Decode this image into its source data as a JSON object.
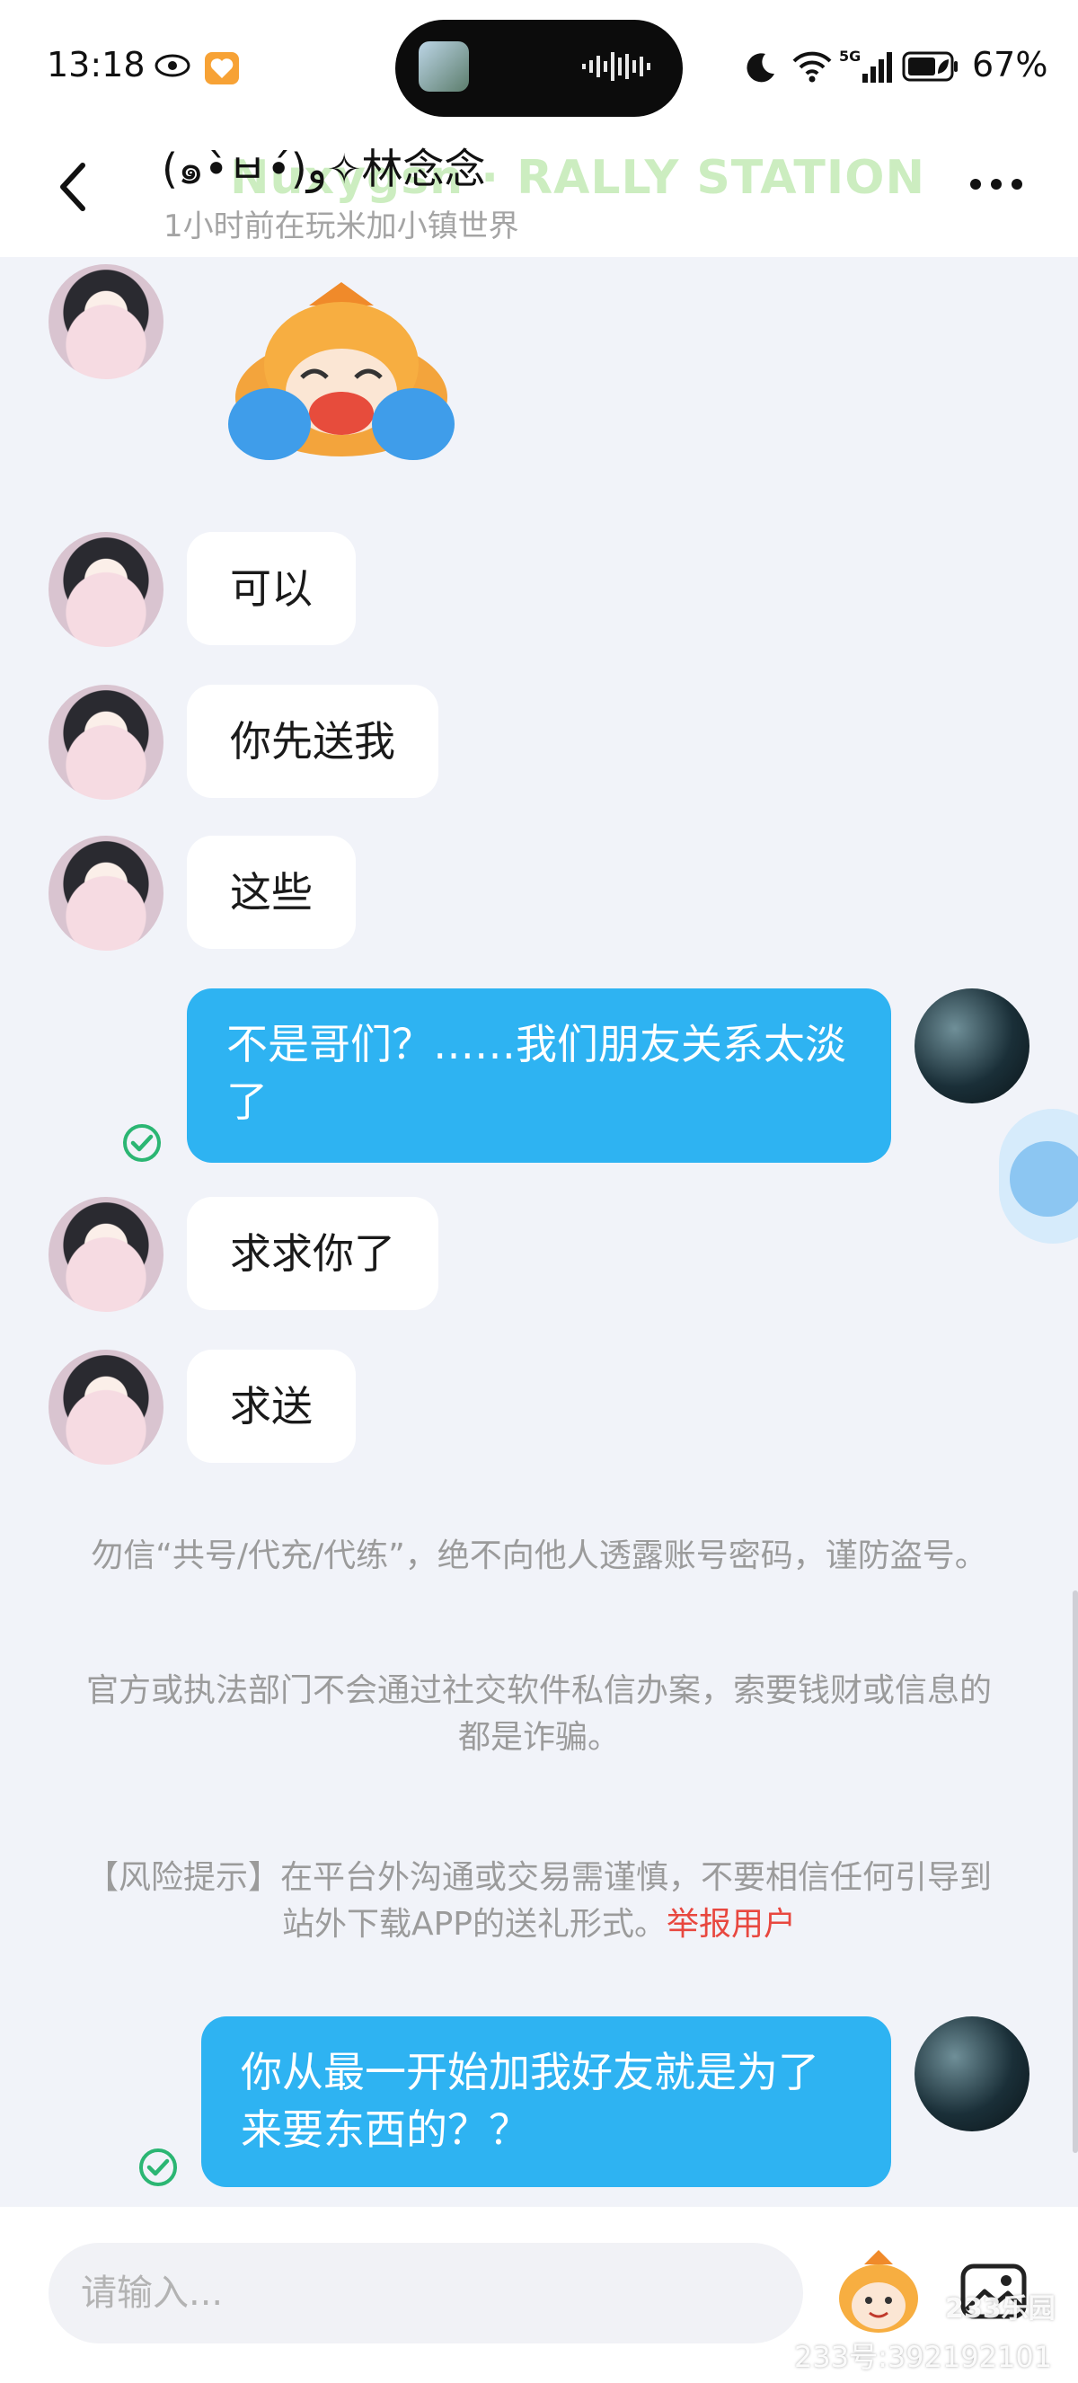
{
  "status": {
    "time": "13:18",
    "battery": "67%",
    "network": "5G"
  },
  "header": {
    "title": "(๑•̀ㅂ•́)و✧林念念",
    "watermark": "Nuxygsn · RALLY STATION",
    "subtitle": "1小时前在玩米加小镇世界"
  },
  "messages": [
    {
      "side": "in",
      "text": "可以"
    },
    {
      "side": "in",
      "text": "你先送我"
    },
    {
      "side": "in",
      "text": "这些"
    },
    {
      "side": "out",
      "text": "不是哥们？……我们朋友关系太淡了"
    },
    {
      "side": "in",
      "text": "求求你了"
    },
    {
      "side": "in",
      "text": "求送"
    },
    {
      "side": "out",
      "text": "你从最一开始加我好友就是为了来要东西的？？"
    }
  ],
  "notices": {
    "n1": "勿信“共号/代充/代练”，绝不向他人透露账号密码，谨防盗号。",
    "n2": "官方或执法部门不会通过社交软件私信办案，索要钱财或信息的都是诈骗。",
    "n3": "【风险提示】在平台外沟通或交易需谨慎，不要相信任何引导到站外下载APP的送礼形式。",
    "report": "举报用户"
  },
  "input": {
    "placeholder": "请输入..."
  },
  "footer": {
    "id": "233号:392192101",
    "logo": "233乐园"
  },
  "colors": {
    "accent": "#2eb3f2",
    "danger": "#e8473f",
    "background": "#f1f3f9"
  }
}
